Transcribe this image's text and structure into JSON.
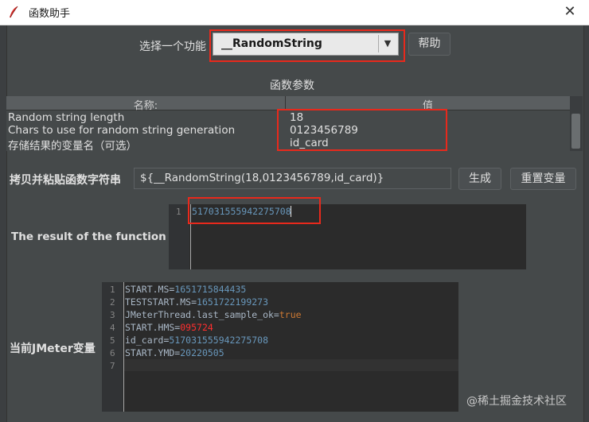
{
  "window": {
    "title": "函数助手",
    "close_glyph": "✕",
    "icon": "feather-icon"
  },
  "function_select": {
    "label": "选择一个功能",
    "value": "__RandomString",
    "arrow": "▼",
    "help_label": "帮助"
  },
  "params": {
    "section_title": "函数参数",
    "columns": [
      "名称:",
      "值"
    ],
    "rows": [
      {
        "name": "Random string length",
        "value": "18"
      },
      {
        "name": "Chars to use for random string generation",
        "value": "0123456789"
      },
      {
        "name": "存储结果的变量名（可选）",
        "value": "id_card"
      }
    ]
  },
  "func_string": {
    "label": "拷贝并粘贴函数字符串",
    "value": "${__RandomString(18,0123456789,id_card)}",
    "generate_label": "生成",
    "reset_label": "重置变量"
  },
  "result": {
    "label": "The result of the function is",
    "lines": [
      {
        "num": "1",
        "text": "517031555942275708"
      }
    ]
  },
  "jmeter_vars": {
    "label": "当前JMeter变量",
    "lines": [
      {
        "num": "1",
        "key": "START.MS=",
        "value": "1651715844435"
      },
      {
        "num": "2",
        "key": "TESTSTART.MS=",
        "value": "1651722199273"
      },
      {
        "num": "3",
        "key": "JMeterThread.last_sample_ok=",
        "value": "true"
      },
      {
        "num": "4",
        "key": "START.HMS=",
        "value": "095724"
      },
      {
        "num": "5",
        "key": "id_card=",
        "value": "517031555942275708"
      },
      {
        "num": "6",
        "key": "START.YMD=",
        "value": "20220505"
      },
      {
        "num": "7",
        "key": "",
        "value": ""
      }
    ]
  },
  "watermark": "@稀土掘金技术社区",
  "colors": {
    "highlight_box": "#e8291c",
    "number": "#6897bb",
    "keyword": "#cc7832",
    "alert_value": "#ff2f2f"
  }
}
